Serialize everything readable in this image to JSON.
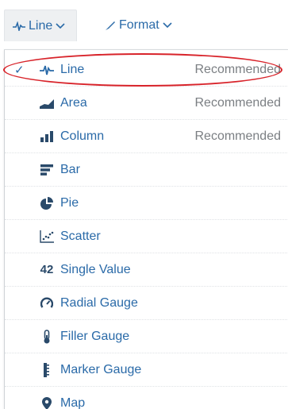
{
  "toolbar": {
    "line_label": "Line",
    "format_label": "Format"
  },
  "menu": {
    "items": [
      {
        "label": "Line",
        "recommended": "Recommended",
        "selected": true,
        "icon": "line-chart-icon"
      },
      {
        "label": "Area",
        "recommended": "Recommended",
        "selected": false,
        "icon": "area-chart-icon"
      },
      {
        "label": "Column",
        "recommended": "Recommended",
        "selected": false,
        "icon": "column-chart-icon"
      },
      {
        "label": "Bar",
        "recommended": "",
        "selected": false,
        "icon": "bar-chart-icon"
      },
      {
        "label": "Pie",
        "recommended": "",
        "selected": false,
        "icon": "pie-chart-icon"
      },
      {
        "label": "Scatter",
        "recommended": "",
        "selected": false,
        "icon": "scatter-chart-icon"
      },
      {
        "label": "Single Value",
        "recommended": "",
        "selected": false,
        "icon": "single-value-icon",
        "icon_text": "42"
      },
      {
        "label": "Radial Gauge",
        "recommended": "",
        "selected": false,
        "icon": "radial-gauge-icon"
      },
      {
        "label": "Filler Gauge",
        "recommended": "",
        "selected": false,
        "icon": "filler-gauge-icon"
      },
      {
        "label": "Marker Gauge",
        "recommended": "",
        "selected": false,
        "icon": "marker-gauge-icon"
      },
      {
        "label": "Map",
        "recommended": "",
        "selected": false,
        "icon": "map-pin-icon"
      }
    ]
  },
  "colors": {
    "accent": "#2a6aa8",
    "icon_dark": "#2a4a6a",
    "muted_text": "#7b7f83",
    "annotation_red": "#d8232a"
  }
}
